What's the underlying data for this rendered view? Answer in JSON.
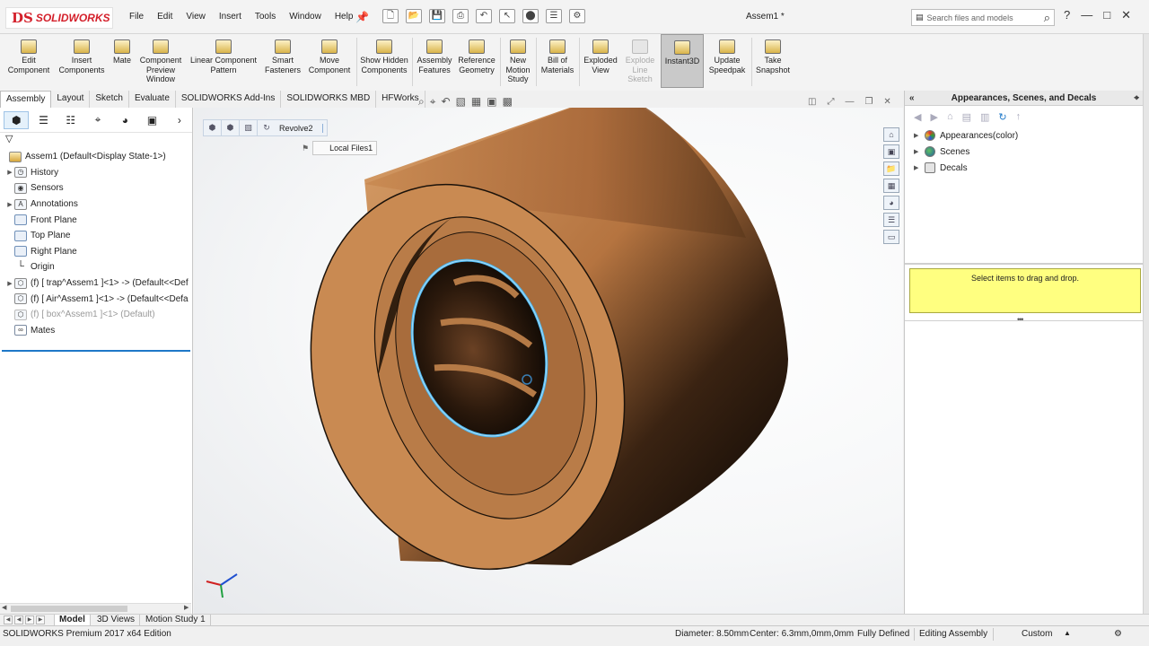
{
  "app": {
    "brand_ds": "DS",
    "brand_sw": "SOLIDWORKS",
    "doc_title": "Assem1 *",
    "menus": [
      "File",
      "Edit",
      "View",
      "Insert",
      "Tools",
      "Window",
      "Help"
    ],
    "search_placeholder": "Search files and models"
  },
  "ribbon": {
    "edit_component": "Edit Component",
    "insert_components": "Insert Components",
    "mate": "Mate",
    "component_preview": "Component Preview Window",
    "linear_pattern": "Linear Component Pattern",
    "smart_fasteners": "Smart Fasteners",
    "move_component": "Move Component",
    "show_hidden": "Show Hidden Components",
    "assembly_features": "Assembly Features",
    "reference_geometry": "Reference Geometry",
    "new_motion_study": "New Motion Study",
    "bill_of_materials": "Bill of Materials",
    "exploded_view": "Exploded View",
    "explode_line_sketch": "Explode Line Sketch",
    "instant3d": "Instant3D",
    "update_speedpak": "Update Speedpak",
    "take_snapshot": "Take Snapshot"
  },
  "tabs": [
    "Assembly",
    "Layout",
    "Sketch",
    "Evaluate",
    "SOLIDWORKS Add-Ins",
    "SOLIDWORKS MBD",
    "HFWorks"
  ],
  "tree": {
    "root": "Assem1  (Default<Display State-1>)",
    "history": "History",
    "sensors": "Sensors",
    "annotations": "Annotations",
    "front_plane": "Front Plane",
    "top_plane": "Top Plane",
    "right_plane": "Right Plane",
    "origin": "Origin",
    "trap": "(f) [ trap^Assem1 ]<1> -> (Default<<Def",
    "air": "(f) [ Air^Assem1 ]<1> -> (Default<<Defa",
    "box": "(f) [ box^Assem1 ]<1> (Default)",
    "mates": "Mates"
  },
  "viewport": {
    "breadcrumb_feature": "Revolve2",
    "local_files": "Local Files1"
  },
  "right_panel": {
    "title": "Appearances, Scenes, and Decals",
    "appearances": "Appearances(color)",
    "scenes": "Scenes",
    "decals": "Decals",
    "drop_hint": "Select items to drag and drop."
  },
  "bottom_tabs": [
    "Model",
    "3D Views",
    "Motion Study 1"
  ],
  "status": {
    "edition": "SOLIDWORKS Premium 2017 x64 Edition",
    "diameter": "Diameter: 8.50mm",
    "center": "Center: 6.3mm,0mm,0mm",
    "defined": "Fully Defined",
    "editing": "Editing Assembly",
    "units": "Custom"
  },
  "colors": {
    "part_face": "#c98a52",
    "part_dark": "#8a5630",
    "selection": "#4db8f0",
    "brand": "#d4202b"
  }
}
